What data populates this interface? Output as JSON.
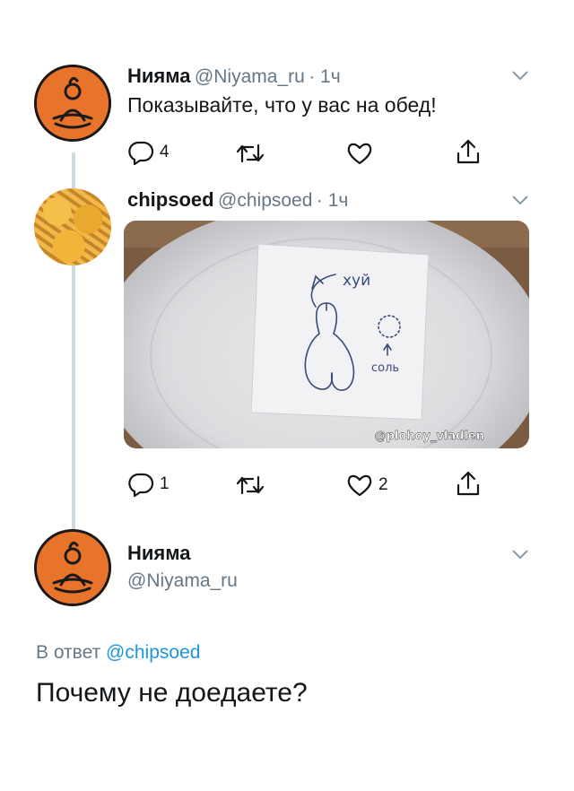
{
  "tweet1": {
    "name": "Нияма",
    "handle": "@Niyama_ru",
    "time": "· 1ч",
    "text": "Показывайте, что у вас на обед!",
    "replies": "4",
    "retweets": "",
    "likes": ""
  },
  "tweet2": {
    "name": "chipsoed",
    "handle": "@chipsoed",
    "time": "· 1ч",
    "image_note_word1": "хуй",
    "image_note_word2": "соль",
    "image_watermark": "@plohoy_vladlen",
    "replies": "1",
    "retweets": "",
    "likes": "2"
  },
  "tweet3": {
    "name": "Нияма",
    "handle": "@Niyama_ru",
    "reply_prefix": "В ответ",
    "reply_to": "@chipsoed",
    "text": "Почему не доедаете?"
  },
  "colors": {
    "brand_orange": "#e8732a",
    "link_blue": "#1b95e0",
    "secondary_text": "#657786"
  }
}
